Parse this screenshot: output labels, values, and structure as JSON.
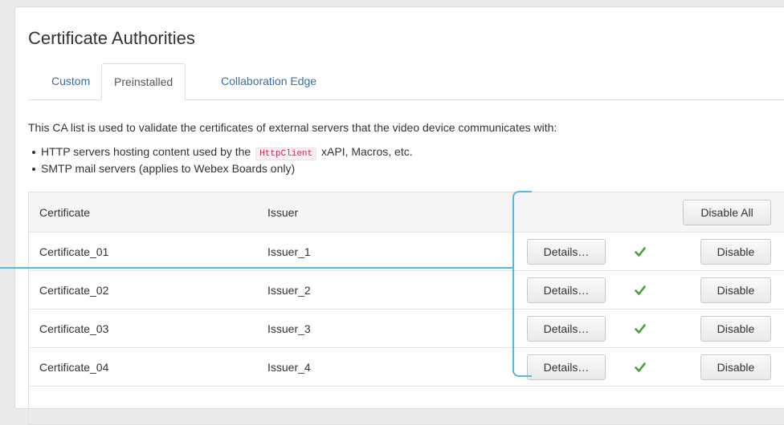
{
  "page": {
    "title": "Certificate Authorities",
    "tabs": [
      {
        "label": "Custom",
        "active": false
      },
      {
        "label": "Preinstalled",
        "active": true
      },
      {
        "label": "Collaboration Edge",
        "active": false
      }
    ],
    "description": "This CA list is used to validate the certificates of external servers that the video device communicates with:",
    "bullets": {
      "b1_pre": "HTTP servers hosting content used by the",
      "b1_code": "HttpClient",
      "b1_post": "xAPI, Macros, etc.",
      "b2": "SMTP mail servers (applies to Webex Boards only)"
    }
  },
  "table": {
    "headers": {
      "certificate": "Certificate",
      "issuer": "Issuer"
    },
    "disable_all_label": "Disable All",
    "details_label": "Details…",
    "disable_label": "Disable",
    "rows": [
      {
        "certificate": "Certificate_01",
        "issuer": "Issuer_1",
        "enabled": true
      },
      {
        "certificate": "Certificate_02",
        "issuer": "Issuer_2",
        "enabled": true
      },
      {
        "certificate": "Certificate_03",
        "issuer": "Issuer_3",
        "enabled": true
      },
      {
        "certificate": "Certificate_04",
        "issuer": "Issuer_4",
        "enabled": true
      }
    ]
  },
  "colors": {
    "link": "#3a6ea5",
    "check": "#4a9a3a",
    "callout": "#5bb8d8",
    "code_text": "#c7254e"
  },
  "icons": {
    "enabled": "checkmark-icon"
  }
}
